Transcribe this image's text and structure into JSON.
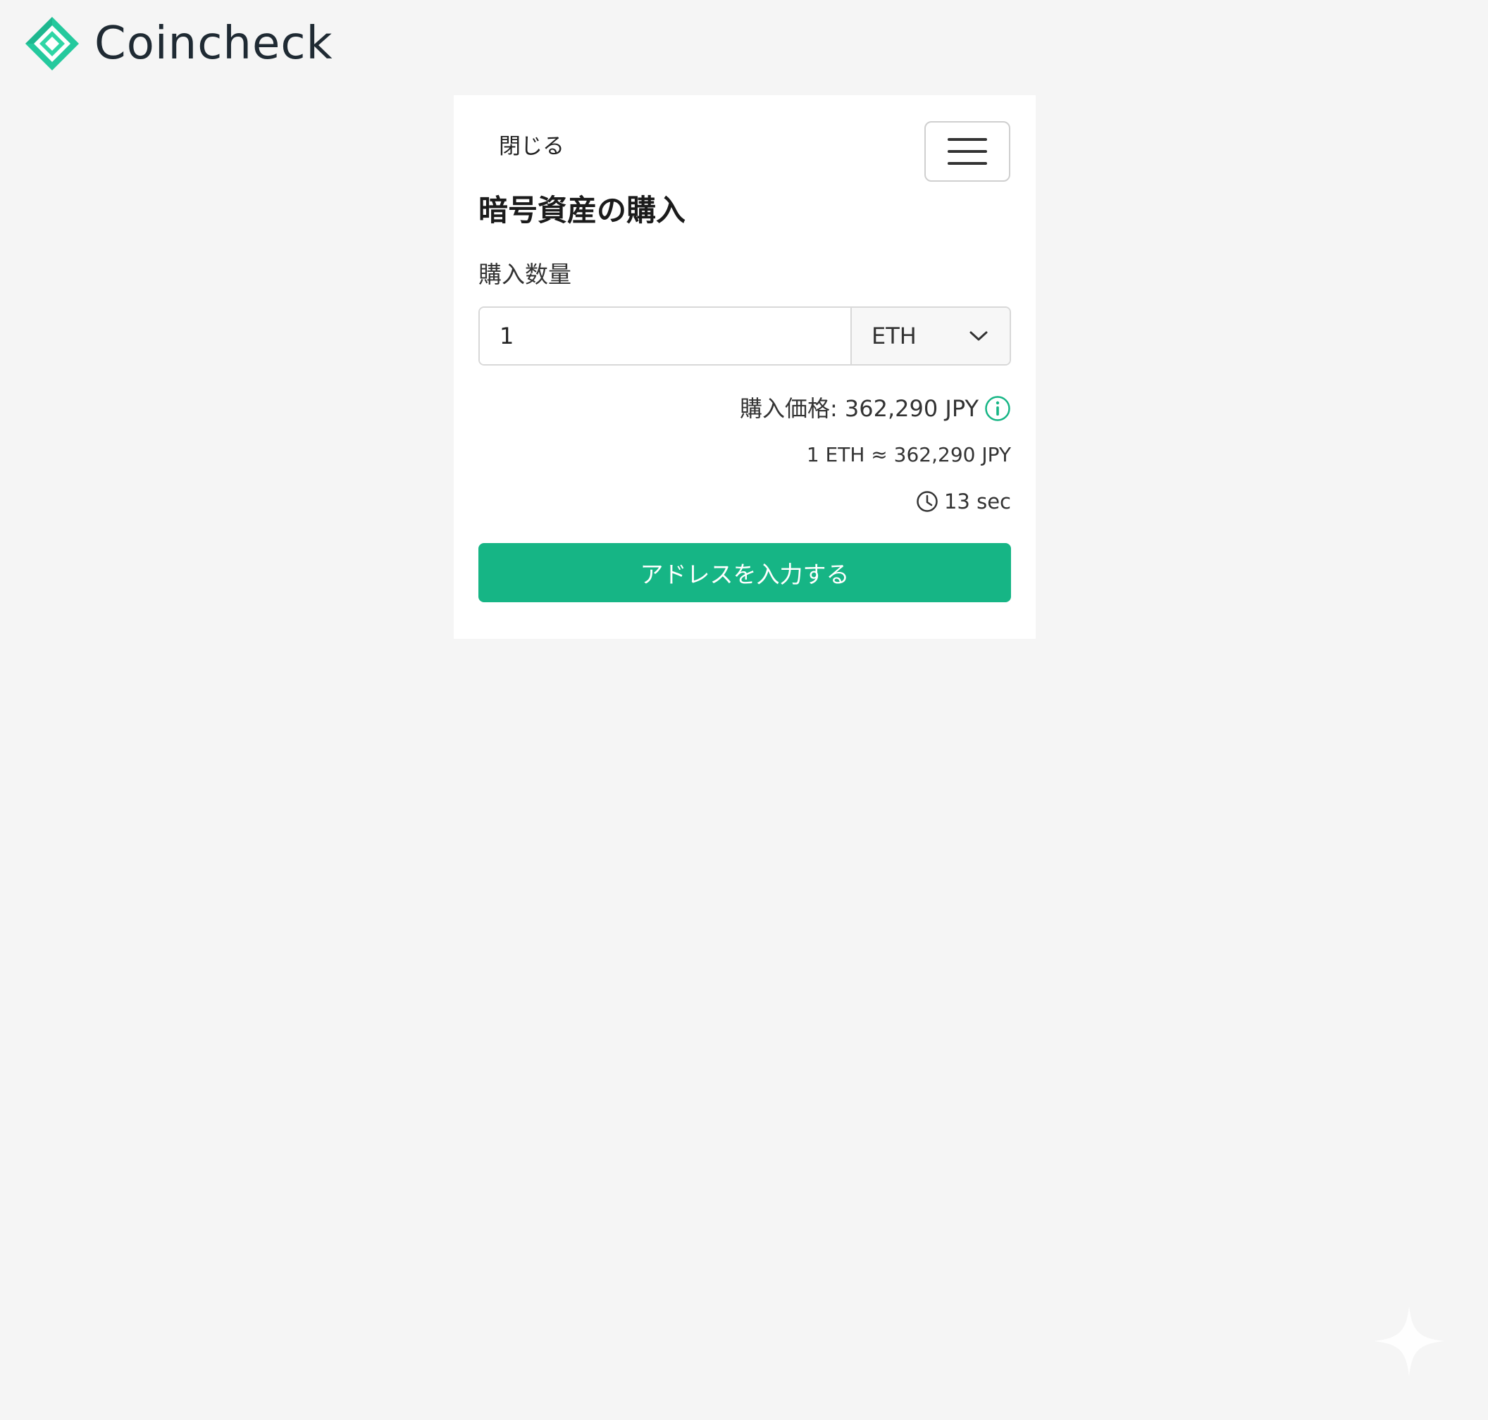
{
  "header": {
    "brand_name": "Coincheck",
    "logo_icon": "coincheck-diamond-logo-icon"
  },
  "card": {
    "close_label": "閉じる",
    "menu_icon": "hamburger-menu-icon",
    "title": "暗号資産の購入",
    "amount_label": "購入数量",
    "amount_value": "1",
    "currency_selected": "ETH",
    "price_text": "購入価格: 362,290 JPY",
    "rate_text": "1 ETH ≈ 362,290 JPY",
    "timer_text": "13 sec",
    "submit_label": "アドレスを入力する"
  },
  "colors": {
    "accent": "#16b585",
    "logo_green": "#1ec99a",
    "background": "#f5f5f5"
  }
}
